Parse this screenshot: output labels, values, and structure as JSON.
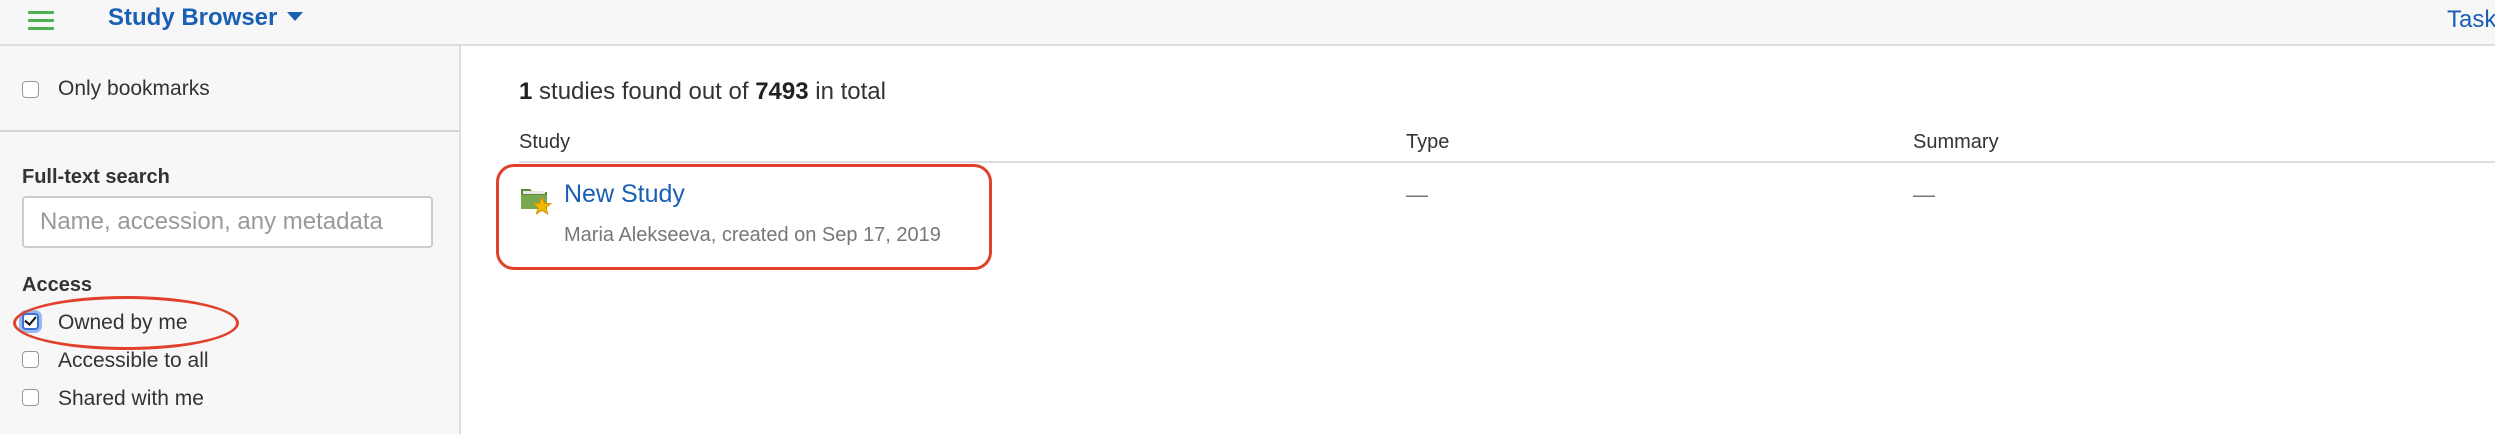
{
  "topbar": {
    "app_title": "Study Browser",
    "tasks_label": "Task"
  },
  "sidebar": {
    "only_bookmarks_label": "Only bookmarks",
    "only_bookmarks_checked": false,
    "search": {
      "heading": "Full-text search",
      "placeholder": "Name, accession, any metadata",
      "value": ""
    },
    "access": {
      "heading": "Access",
      "options": [
        {
          "label": "Owned by me",
          "checked": true
        },
        {
          "label": "Accessible to all",
          "checked": false
        },
        {
          "label": "Shared with me",
          "checked": false
        }
      ]
    }
  },
  "main": {
    "found_count": "1",
    "found_text": " studies found out of ",
    "total_count": "7493",
    "total_text": " in total",
    "columns": [
      "Study",
      "Type",
      "Summary"
    ],
    "rows": [
      {
        "icon": "study-folder-star-icon",
        "name": "New Study",
        "meta": "Maria Alekseeva, created on Sep 17, 2019",
        "type": "—",
        "summary": "—"
      }
    ]
  },
  "colors": {
    "link": "#1a5fb4",
    "menu_icon": "#4caf50",
    "annotation": "#e0412a"
  }
}
